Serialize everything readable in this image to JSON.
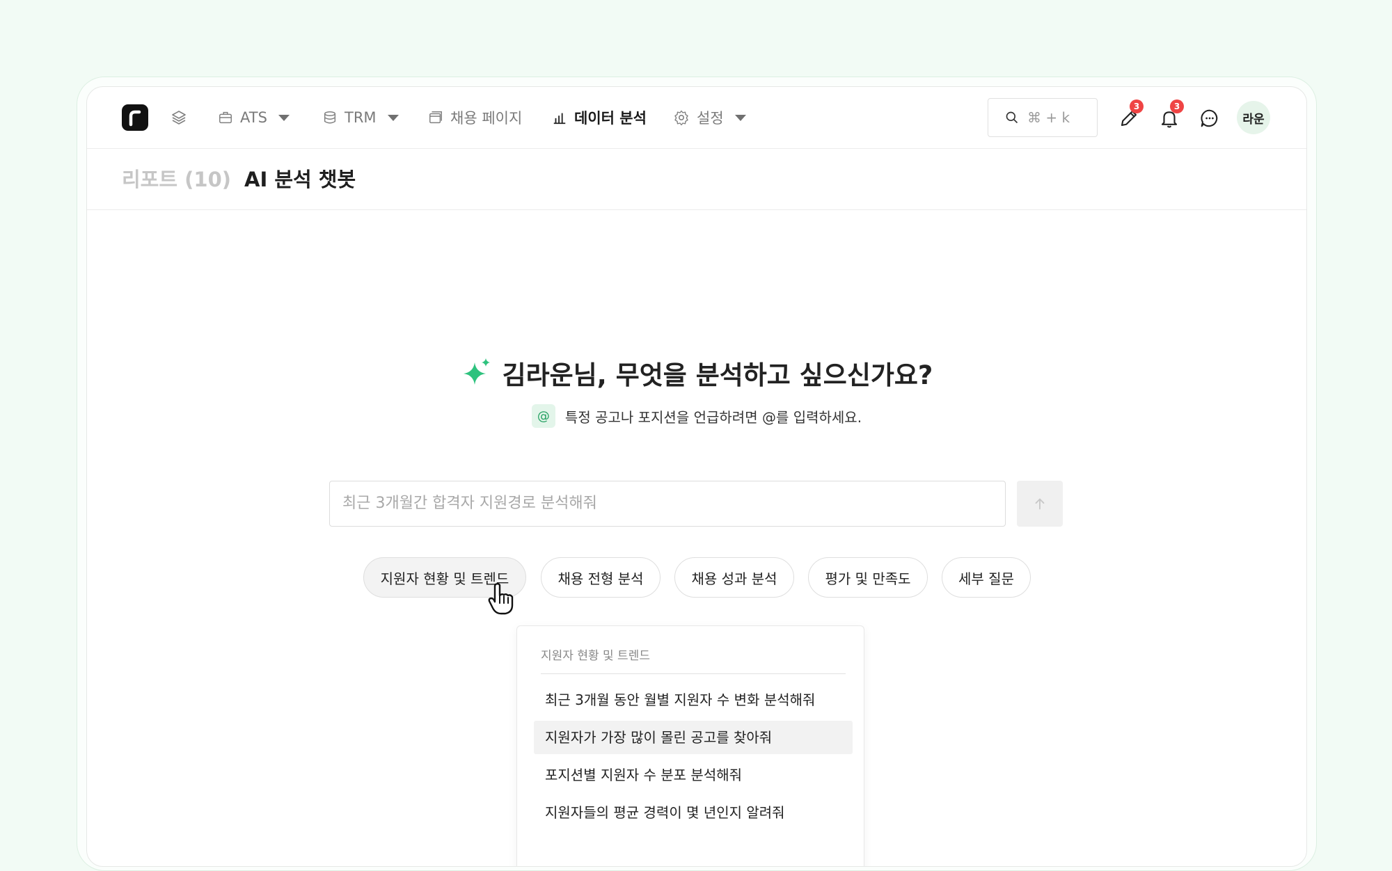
{
  "nav": {
    "ats": "ATS",
    "trm": "TRM",
    "career_page": "채용 페이지",
    "data_analysis": "데이터 분석",
    "settings": "설정"
  },
  "search": {
    "placeholder": "⌘ + k"
  },
  "badges": {
    "edit": "3",
    "notifications": "3"
  },
  "user": {
    "avatar": "라운"
  },
  "tabs": {
    "reports": "리포트 (10)",
    "chatbot": "AI 분석 챗봇"
  },
  "main": {
    "greeting": "김라운님, 무엇을 분석하고 싶으신가요?",
    "hint": "특정 공고나 포지션을 언급하려면 @를 입력하세요.",
    "input_placeholder": "최근 3개월간 합격자 지원경로 분석해줘"
  },
  "chips": [
    "지원자 현황 및 트렌드",
    "채용 전형 분석",
    "채용 성과 분석",
    "평가 및 만족도",
    "세부 질문"
  ],
  "dropdown": {
    "header": "지원자 현황 및 트렌드",
    "items": [
      "최근 3개월 동안 월별 지원자 수 변화 분석해줘",
      "지원자가 가장 많이 몰린 공고를 찾아줘",
      "포지션별 지원자 수 분포 분석해줘",
      "지원자들의 평균 경력이 몇 년인지 알려줘"
    ]
  },
  "icons": {
    "logo": "logo-icon",
    "layers": "layers-icon",
    "briefcase": "briefcase-icon",
    "database": "database-icon",
    "window": "window-icon",
    "chart": "bar-chart-icon",
    "gear": "gear-icon",
    "search": "search-icon",
    "pencil": "pencil-icon",
    "bell": "bell-icon",
    "chat": "chat-icon",
    "sparkle": "sparkle-icon",
    "send": "arrow-up-icon"
  },
  "colors": {
    "accent": "#2ec27e",
    "badge": "#ef4444",
    "background": "#f2fbf5"
  }
}
